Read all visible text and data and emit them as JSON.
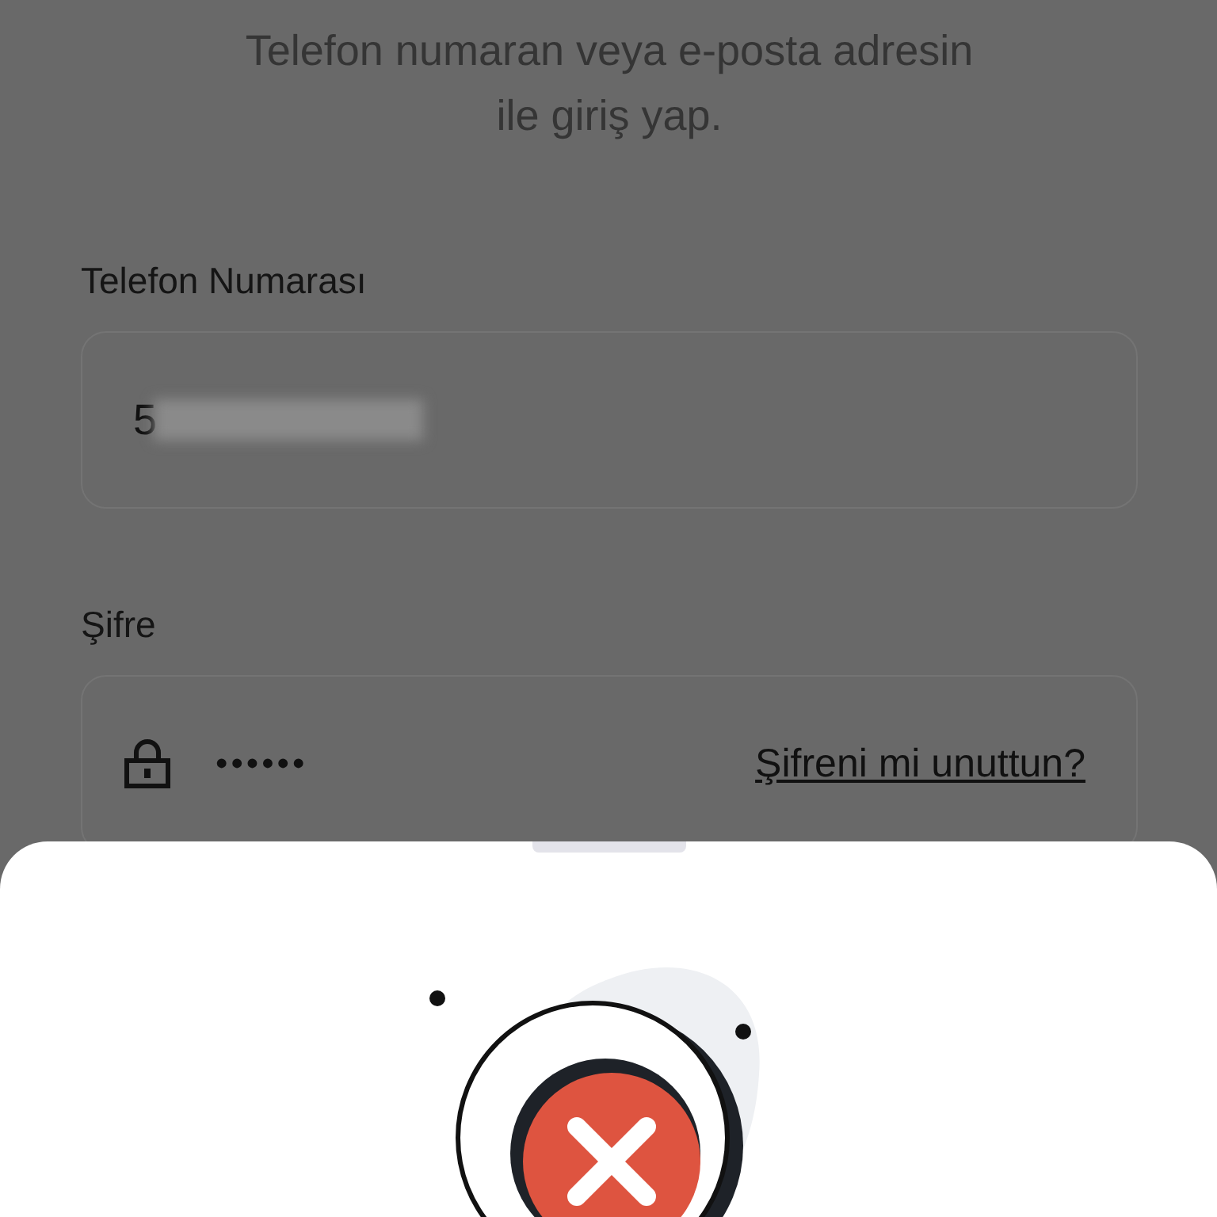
{
  "subtitle": [
    "Telefon numaran veya e-posta adresin",
    "ile giriş yap."
  ],
  "phone": {
    "label": "Telefon Numarası",
    "value": "5"
  },
  "password": {
    "label": "Şifre",
    "value": "••••••",
    "forgot_link": "Şifreni mi unuttun?"
  },
  "sheet": {
    "kind": "error"
  }
}
